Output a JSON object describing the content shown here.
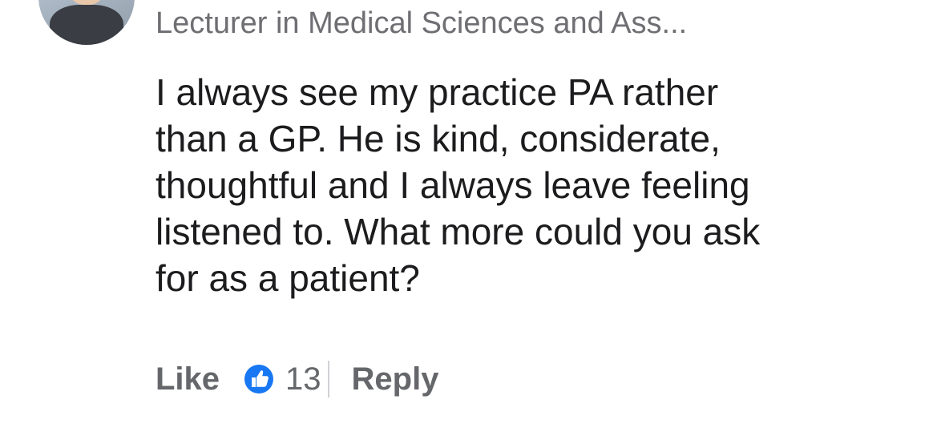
{
  "comment": {
    "author_headline": "Lecturer in Medical Sciences and Ass...",
    "text_lines": [
      "I always see my practice PA rather",
      "than a GP. He is kind, considerate,",
      "thoughtful and I always leave feeling",
      "listened to. What more could you ask",
      "for as a patient?"
    ]
  },
  "actions": {
    "like_label": "Like",
    "reaction_icon": "thumbs-up-icon",
    "reaction_count": "13",
    "reply_label": "Reply"
  },
  "colors": {
    "secondary_text": "#6e6e73",
    "action_text": "#65676b",
    "like_blue": "#1877f2"
  }
}
